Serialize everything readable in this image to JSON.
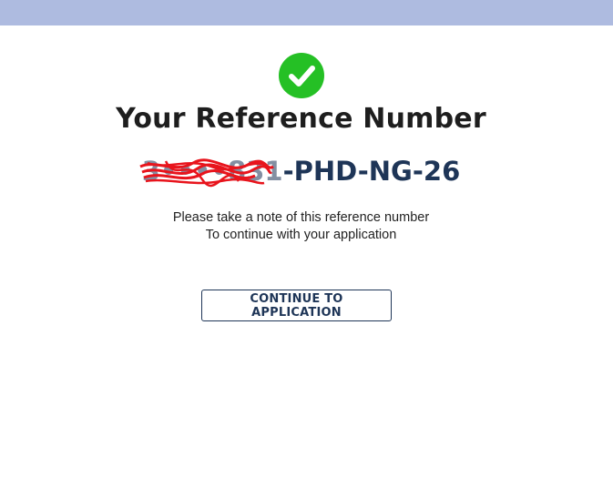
{
  "header": {
    "bar_color": "#aebbe0"
  },
  "status": {
    "icon": "check-circle-icon",
    "icon_color": "#25c025"
  },
  "title": "Your Reference Number",
  "reference": {
    "redacted_part": "3••••831",
    "visible_part": "-PHD-NG-26",
    "color": "#1e3557"
  },
  "note": {
    "line1": "Please take a note of this reference number",
    "line2": "To continue with your application"
  },
  "actions": {
    "continue_label": "CONTINUE TO APPLICATION"
  }
}
